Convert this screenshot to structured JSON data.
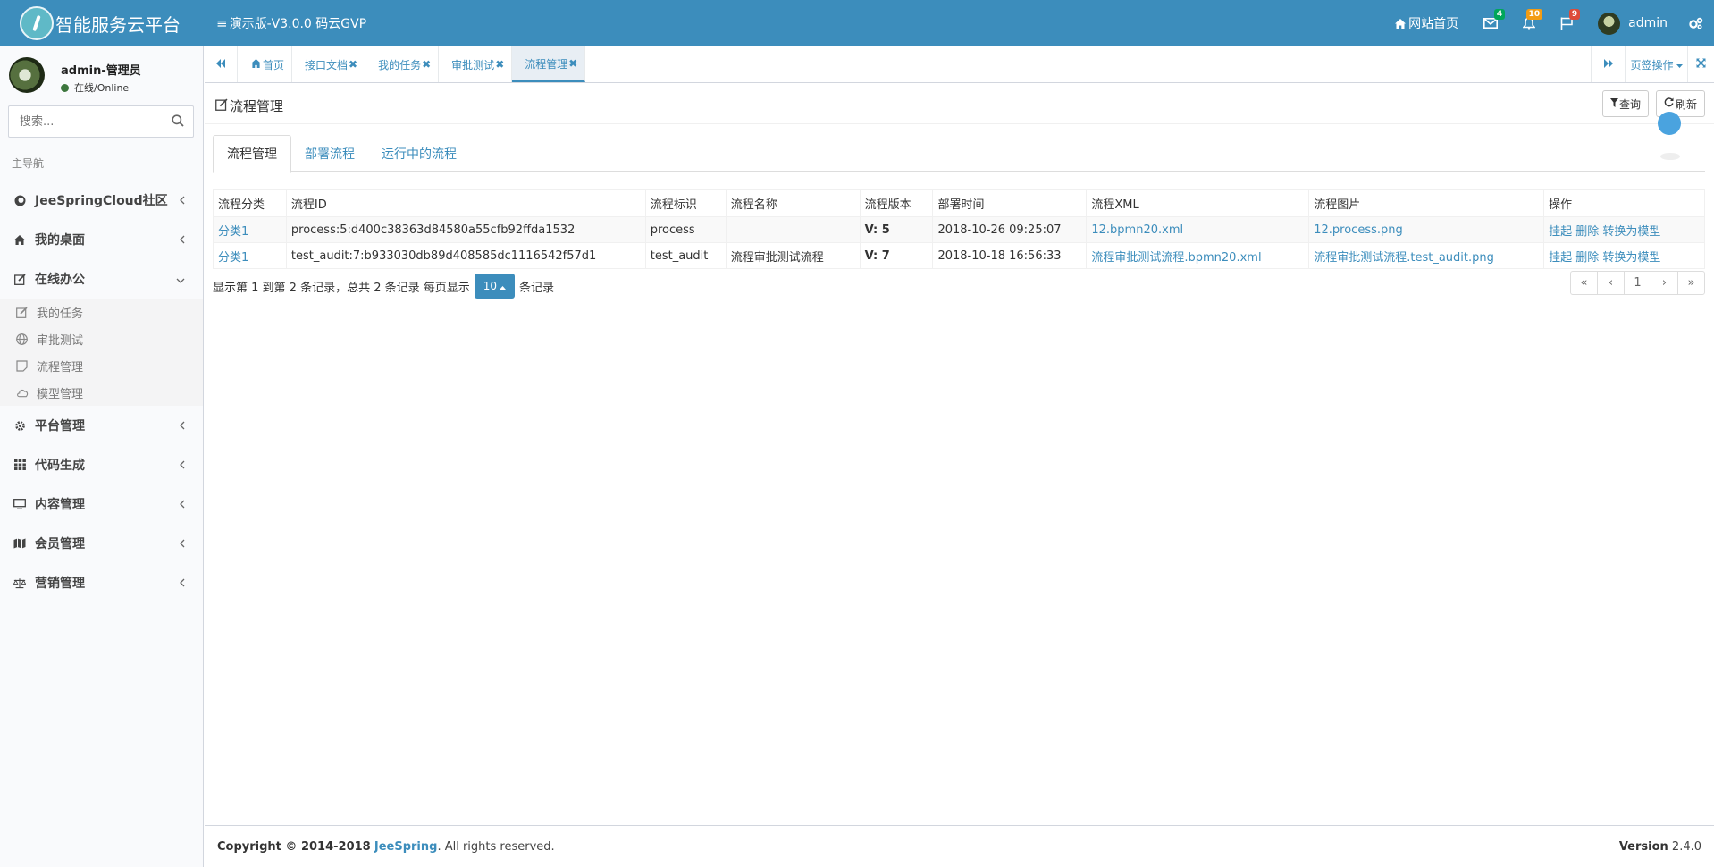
{
  "app": {
    "title": "智能服务云平台",
    "subtitle": "演示版-V3.0.0 码云GVP"
  },
  "topbar": {
    "home_label": "网站首页",
    "mail_count": "4",
    "bell_count": "10",
    "flag_count": "9",
    "user_name": "admin"
  },
  "sidebar": {
    "user_name": "admin-管理员",
    "user_status": "在线/Online",
    "search_placeholder": "搜索...",
    "nav_header": "主导航",
    "items": [
      {
        "label": "JeeSpringCloud社区"
      },
      {
        "label": "我的桌面"
      },
      {
        "label": "在线办公"
      },
      {
        "label": "平台管理"
      },
      {
        "label": "代码生成"
      },
      {
        "label": "内容管理"
      },
      {
        "label": "会员管理"
      },
      {
        "label": "营销管理"
      }
    ],
    "sub_items": [
      {
        "label": "我的任务"
      },
      {
        "label": "审批测试"
      },
      {
        "label": "流程管理"
      },
      {
        "label": "模型管理"
      }
    ]
  },
  "tabbar": {
    "tabs": [
      {
        "label": "首页"
      },
      {
        "label": "接口文档"
      },
      {
        "label": "我的任务"
      },
      {
        "label": "审批测试"
      },
      {
        "label": "流程管理"
      }
    ],
    "page_ops": "页签操作"
  },
  "content": {
    "title": "流程管理",
    "query_label": "查询",
    "refresh_label": "刷新",
    "subtabs": [
      {
        "label": "流程管理"
      },
      {
        "label": "部署流程"
      },
      {
        "label": "运行中的流程"
      }
    ],
    "table": {
      "headers": [
        "流程分类",
        "流程ID",
        "流程标识",
        "流程名称",
        "流程版本",
        "部署时间",
        "流程XML",
        "流程图片",
        "操作"
      ],
      "rows": [
        {
          "category": "分类1",
          "id": "process:5:d400c38363d84580a55cfb92ffda1532",
          "key": "process",
          "name": "",
          "version": "V: 5",
          "time": "2018-10-26 09:25:07",
          "xml": "12.bpmn20.xml",
          "image": "12.process.png",
          "act_suspend": "挂起",
          "act_delete": "删除",
          "act_convert": "转换为模型"
        },
        {
          "category": "分类1",
          "id": "test_audit:7:b933030db89d408585dc1116542f57d1",
          "key": "test_audit",
          "name": "流程审批测试流程",
          "version": "V: 7",
          "time": "2018-10-18 16:56:33",
          "xml": "流程审批测试流程.bpmn20.xml",
          "image": "流程审批测试流程.test_audit.png",
          "act_suspend": "挂起",
          "act_delete": "删除",
          "act_convert": "转换为模型"
        }
      ]
    },
    "pager": {
      "info_prefix": "显示第 1 到第 2 条记录，总共 2 条记录 每页显示",
      "page_size": "10",
      "info_suffix": "条记录",
      "first": "«",
      "prev": "‹",
      "current": "1",
      "next": "›",
      "last": "»"
    }
  },
  "footer": {
    "copyright_prefix": "Copyright © 2014-2018",
    "brand": "JeeSpring",
    "copyright_suffix": ". All rights reserved.",
    "version_label": "Version",
    "version": "2.4.0"
  },
  "colors": {
    "primary": "#3c8dbc",
    "sidebar_bg": "#f9fafc",
    "badge_green": "#00a65a",
    "badge_orange": "#f39c12",
    "badge_red": "#dd4b39"
  }
}
